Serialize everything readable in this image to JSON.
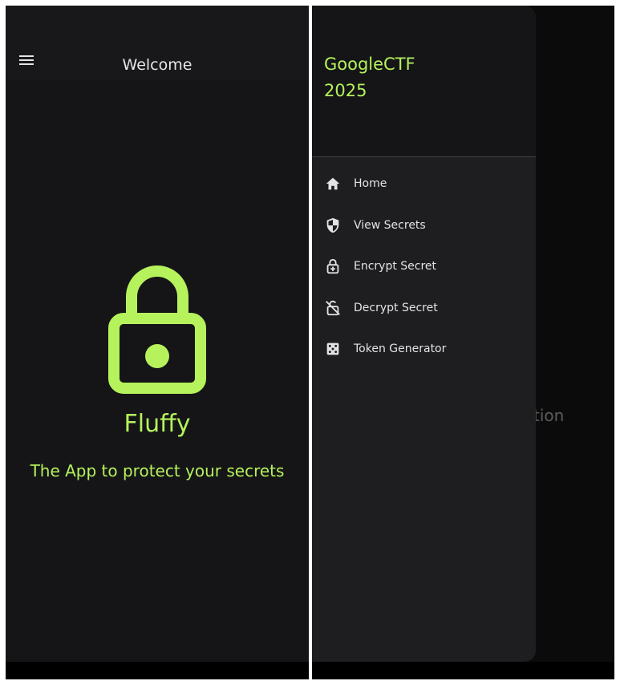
{
  "left_screen": {
    "app_bar": {
      "menu_icon": "hamburger-menu-icon",
      "title": "Welcome"
    },
    "hero": {
      "icon": "lock-icon",
      "brand": "Fluffy",
      "tagline": "The App to protect your secrets"
    }
  },
  "right_screen": {
    "drawer": {
      "title": "GoogleCTF\n2025",
      "items": [
        {
          "label": "Home",
          "icon": "home-icon"
        },
        {
          "label": "View Secrets",
          "icon": "shield-icon"
        },
        {
          "label": "Encrypt Secret",
          "icon": "lock-plus-icon"
        },
        {
          "label": "Decrypt Secret",
          "icon": "lock-off-icon"
        },
        {
          "label": "Token Generator",
          "icon": "dice-icon"
        }
      ]
    },
    "background_text": "tion"
  },
  "colors": {
    "accent": "#b5f25c",
    "background": "#151517",
    "drawer": "#1e1e21"
  }
}
